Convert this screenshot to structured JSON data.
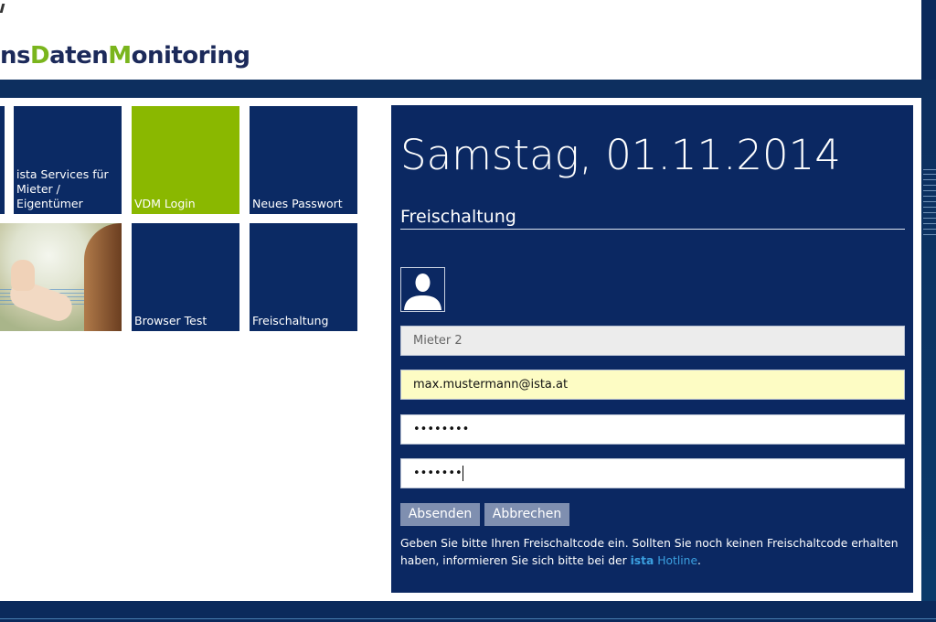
{
  "header": {
    "logo_part1": "ns",
    "logo_D": "D",
    "logo_part2": "aten",
    "logo_M": "M",
    "logo_part3": "onitoring"
  },
  "tiles": [
    {
      "label": "ista Services für Mieter / Eigentümer"
    },
    {
      "label": "VDM Login"
    },
    {
      "label": "Neues Passwort"
    },
    {
      "label": "Browser Test"
    },
    {
      "label": "Freischaltung"
    }
  ],
  "panel": {
    "date": "Samstag, 01.11.2014",
    "section_title": "Freischaltung",
    "fields": {
      "user": "Mieter 2",
      "email": "max.mustermann@ista.at",
      "password1": "••••••••",
      "password2": "•••••••"
    },
    "buttons": {
      "submit": "Absenden",
      "cancel": "Abbrechen"
    },
    "info": {
      "text": "Geben Sie bitte Ihren Freischaltcode ein. Sollten Sie noch keinen Freischaltcode erhalten haben, informieren Sie sich bitte bei der ",
      "link_brand": "ista",
      "link_text": "Hotline",
      "end": "."
    }
  },
  "colors": {
    "navy": "#0b2862",
    "green": "#8ab800",
    "button": "#7f8fb0",
    "link": "#3ba0e0",
    "autofill": "#fdfcc4"
  }
}
